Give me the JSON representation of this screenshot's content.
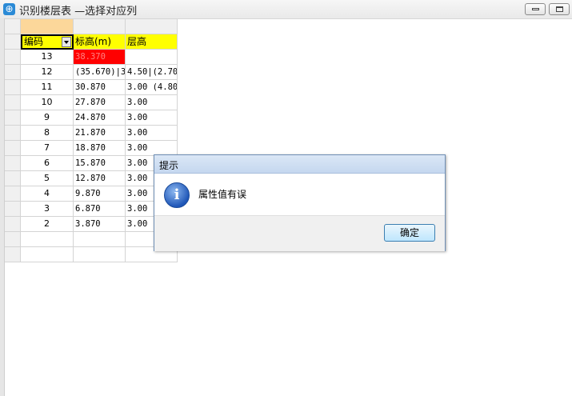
{
  "window": {
    "title": "识别楼层表 —选择对应列",
    "icon": "app-icon"
  },
  "table": {
    "headers": [
      "编码",
      "标高(m)",
      "层高"
    ],
    "rows": [
      [
        "13",
        "38.370",
        ""
      ],
      [
        "12",
        "(35.670)|3",
        "4.50|(2.70"
      ],
      [
        "11",
        "30.870",
        "3.00 (4.80"
      ],
      [
        "10",
        "27.870",
        "3.00"
      ],
      [
        "9",
        "24.870",
        "3.00"
      ],
      [
        "8",
        "21.870",
        "3.00"
      ],
      [
        "7",
        "18.870",
        "3.00"
      ],
      [
        "6",
        "15.870",
        "3.00"
      ],
      [
        "5",
        "12.870",
        "3.00"
      ],
      [
        "4",
        "9.870",
        "3.00"
      ],
      [
        "3",
        "6.870",
        "3.00"
      ],
      [
        "2",
        "3.870",
        "3.00"
      ],
      [
        "",
        "",
        ""
      ],
      [
        "",
        "",
        ""
      ]
    ]
  },
  "dialog": {
    "title": "提示",
    "message": "属性值有误",
    "ok_label": "确定"
  }
}
